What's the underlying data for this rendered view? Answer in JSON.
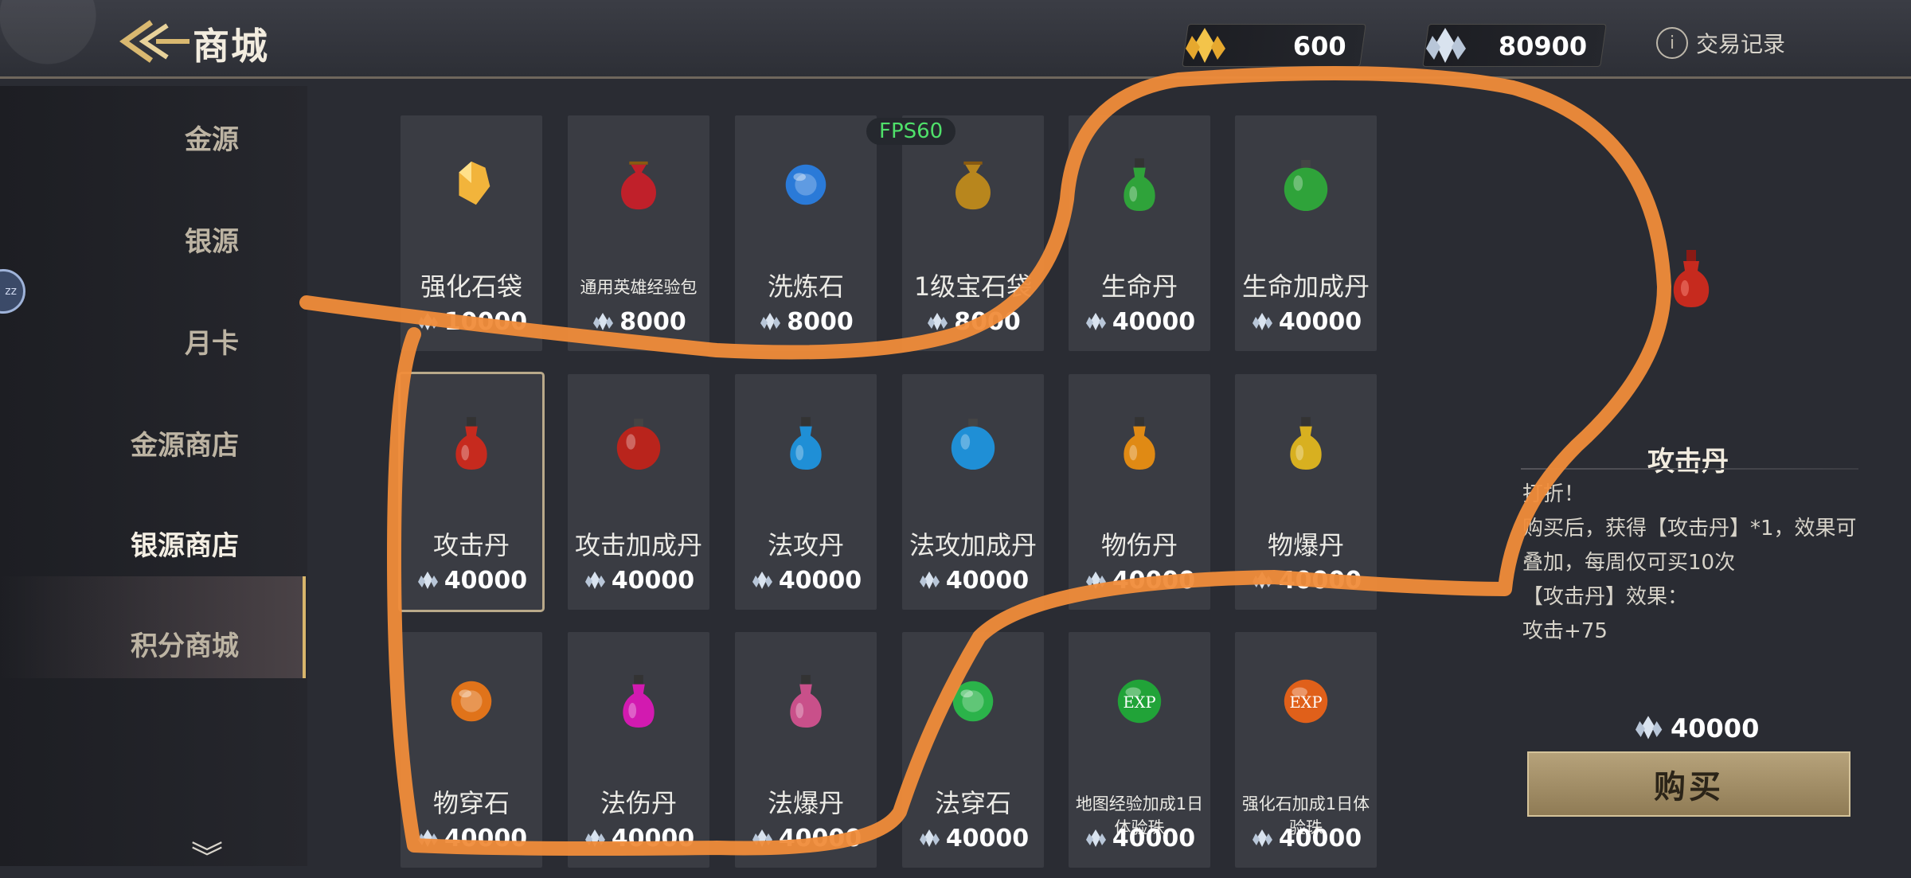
{
  "header": {
    "title": "商城",
    "history_label": "交易记录",
    "info_glyph": "i"
  },
  "currencies": [
    {
      "name": "gold-crystal",
      "value": "600"
    },
    {
      "name": "silver-crystal",
      "value": "80900"
    }
  ],
  "sidebar": {
    "items": [
      {
        "label": "金源"
      },
      {
        "label": "银源"
      },
      {
        "label": "月卡"
      },
      {
        "label": "金源商店"
      },
      {
        "label": "银源商店"
      },
      {
        "label": "积分商城"
      }
    ],
    "active_index": 4,
    "more_glyph": "︾",
    "float_badge": "zz"
  },
  "fps_label": "FPS60",
  "items": [
    {
      "name": "强化石袋",
      "price": "10000",
      "icon": "gold-gem-icon",
      "color": "#f2b43b"
    },
    {
      "name": "通用英雄经验包",
      "price": "8000",
      "icon": "red-pouch-icon",
      "color": "#c0202a",
      "small": true
    },
    {
      "name": "洗炼石",
      "price": "8000",
      "icon": "blue-orb-icon",
      "color": "#2a7ad8"
    },
    {
      "name": "1级宝石袋",
      "price": "8000",
      "icon": "gold-pouch-icon",
      "color": "#b8861d"
    },
    {
      "name": "生命丹",
      "price": "40000",
      "icon": "green-potion-icon",
      "color": "#2fa33a"
    },
    {
      "name": "生命加成丹",
      "price": "40000",
      "icon": "green-flask-icon",
      "color": "#2fa33a"
    },
    {
      "name": "攻击丹",
      "price": "40000",
      "icon": "red-potion-icon",
      "color": "#c62a1e"
    },
    {
      "name": "攻击加成丹",
      "price": "40000",
      "icon": "red-flask-icon",
      "color": "#b9241c"
    },
    {
      "name": "法攻丹",
      "price": "40000",
      "icon": "blue-potion-icon",
      "color": "#1f8fd6"
    },
    {
      "name": "法攻加成丹",
      "price": "40000",
      "icon": "blue-flask-icon",
      "color": "#1f8fd6"
    },
    {
      "name": "物伤丹",
      "price": "40000",
      "icon": "orange-potion-icon",
      "color": "#e08a14"
    },
    {
      "name": "物爆丹",
      "price": "40000",
      "icon": "yellow-potion-icon",
      "color": "#d8b020"
    },
    {
      "name": "物穿石",
      "price": "40000",
      "icon": "orange-stone-icon",
      "color": "#e0731a"
    },
    {
      "name": "法伤丹",
      "price": "40000",
      "icon": "magenta-potion-icon",
      "color": "#d21ab0"
    },
    {
      "name": "法爆丹",
      "price": "40000",
      "icon": "rainbow-potion-icon",
      "color": "#c9508a"
    },
    {
      "name": "法穿石",
      "price": "40000",
      "icon": "green-stone-icon",
      "color": "#2bb34a"
    },
    {
      "name": "地图经验加成1日体验珠",
      "price": "40000",
      "icon": "exp-green-orb-icon",
      "color": "#21a338",
      "small": true,
      "orb_text": "EXP"
    },
    {
      "name": "强化石加成1日体验珠",
      "price": "40000",
      "icon": "exp-orange-orb-icon",
      "color": "#e0601a",
      "small": true,
      "orb_text": "EXP"
    }
  ],
  "selected_index": 6,
  "detail": {
    "title": "攻击丹",
    "lines": [
      "打折！",
      "购买后，获得【攻击丹】*1，效果可叠加，每周仅可买10次",
      "【攻击丹】效果：",
      "攻击+75"
    ],
    "price": "40000",
    "buy_label": "购买"
  }
}
